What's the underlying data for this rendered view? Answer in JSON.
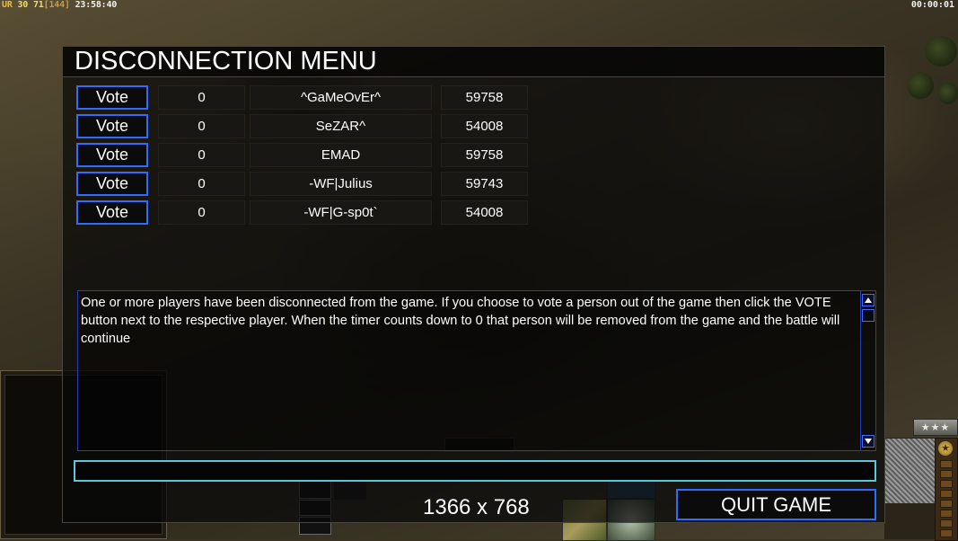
{
  "hud": {
    "ur_label": "UR",
    "fps": "30",
    "fps_avg": "71",
    "fps_cap": "[144]",
    "clock": "23:58:40",
    "game_timer": "00:00:01",
    "rank_stars": "★★★"
  },
  "dialog": {
    "title": "DISCONNECTION MENU",
    "vote_label": "Vote",
    "players": [
      {
        "timer": "0",
        "name": "^GaMeOvEr^",
        "ping": "59758"
      },
      {
        "timer": "0",
        "name": "SeZAR^",
        "ping": "54008"
      },
      {
        "timer": "0",
        "name": "EMAD",
        "ping": "59758"
      },
      {
        "timer": "0",
        "name": "-WF|Julius",
        "ping": "59743"
      },
      {
        "timer": "0",
        "name": "-WF|G-sp0t`",
        "ping": "54008"
      }
    ],
    "message": "One or more players have been disconnected from the game. If you choose to vote a person out of the game then click the VOTE button next to the respective player. When the timer counts down to 0 that person will be removed from the game and the battle will continue",
    "chat_value": "",
    "resolution": "1366 x 768",
    "quit_label": "QUIT GAME"
  },
  "colors": {
    "border_blue": "#2640b8",
    "button_blue": "#2f6bff",
    "input_cyan": "#5bc7d9"
  },
  "icons": [
    "scroll-up-icon",
    "scroll-down-icon",
    "medal-icon",
    "wrench-icon"
  ]
}
